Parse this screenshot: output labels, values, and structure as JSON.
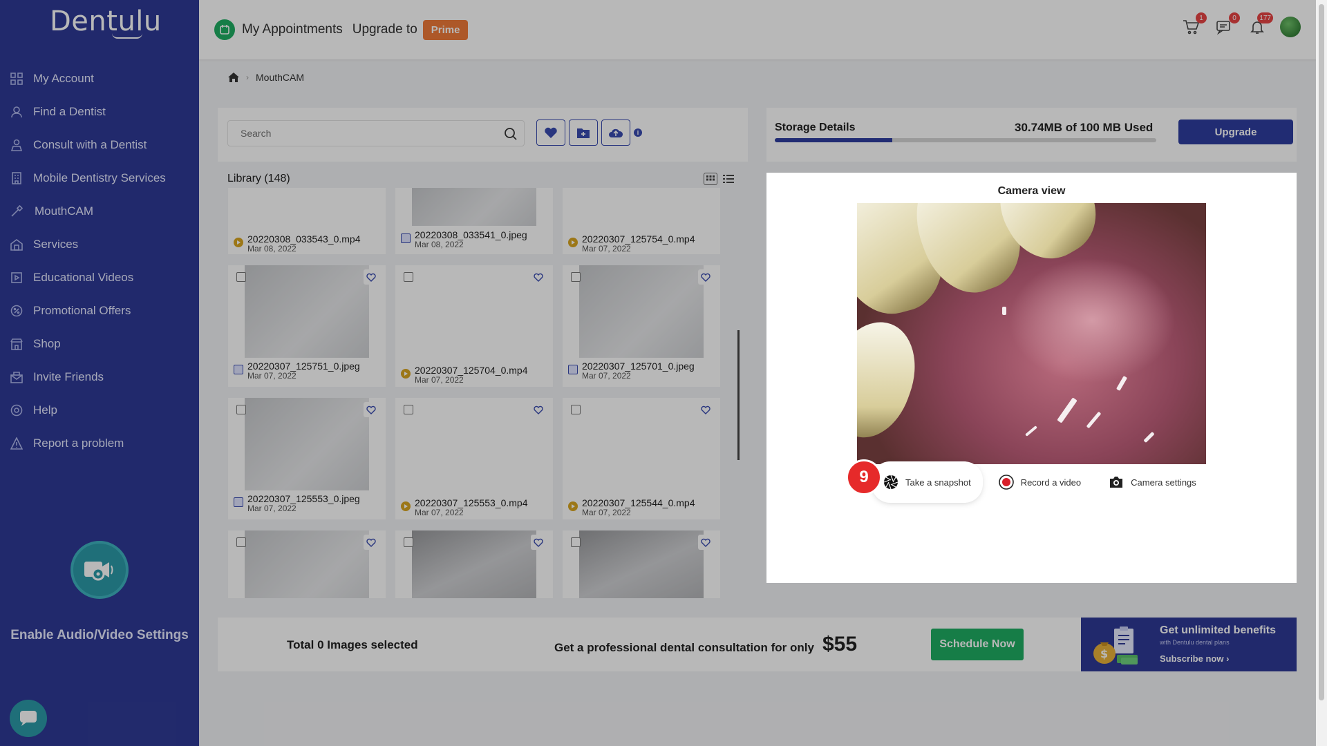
{
  "brand": {
    "logo_text": "Dentulu"
  },
  "sidebar": {
    "items": [
      {
        "label": "My Account",
        "icon": "grid-icon"
      },
      {
        "label": "Find a Dentist",
        "icon": "person-icon"
      },
      {
        "label": "Consult with a Dentist",
        "icon": "consult-icon"
      },
      {
        "label": "Mobile Dentistry Services",
        "icon": "building-icon"
      },
      {
        "label": "MouthCAM",
        "icon": "camera-wand-icon"
      },
      {
        "label": "Services",
        "icon": "services-icon"
      },
      {
        "label": "Educational Videos",
        "icon": "video-icon"
      },
      {
        "label": "Promotional Offers",
        "icon": "tag-icon"
      },
      {
        "label": "Shop",
        "icon": "shop-icon"
      },
      {
        "label": "Invite Friends",
        "icon": "invite-icon"
      },
      {
        "label": "Help",
        "icon": "help-icon"
      },
      {
        "label": "Report a problem",
        "icon": "warning-icon"
      }
    ],
    "av_settings_label": "Enable Audio/Video Settings"
  },
  "header": {
    "title": "My Appointments",
    "upgrade_text": "Upgrade to",
    "prime_label": "Prime",
    "cart_count": "1",
    "messages_count": "0",
    "notifications_count": "177"
  },
  "breadcrumb": {
    "current": "MouthCAM"
  },
  "toolbar": {
    "search_placeholder": "Search"
  },
  "library": {
    "title": "Library (148)",
    "items": [
      {
        "name": "20220308_033543_0.mp4",
        "date": "Mar 08, 2022",
        "type": "video"
      },
      {
        "name": "20220308_033541_0.jpeg",
        "date": "Mar 08, 2022",
        "type": "image"
      },
      {
        "name": "20220307_125754_0.mp4",
        "date": "Mar 07, 2022",
        "type": "video"
      },
      {
        "name": "20220307_125751_0.jpeg",
        "date": "Mar 07, 2022",
        "type": "image"
      },
      {
        "name": "20220307_125704_0.mp4",
        "date": "Mar 07, 2022",
        "type": "video"
      },
      {
        "name": "20220307_125701_0.jpeg",
        "date": "Mar 07, 2022",
        "type": "image"
      },
      {
        "name": "20220307_125553_0.jpeg",
        "date": "Mar 07, 2022",
        "type": "image"
      },
      {
        "name": "20220307_125553_0.mp4",
        "date": "Mar 07, 2022",
        "type": "video"
      },
      {
        "name": "20220307_125544_0.mp4",
        "date": "Mar 07, 2022",
        "type": "video"
      }
    ]
  },
  "storage": {
    "label": "Storage Details",
    "used_text": "30.74MB of 100 MB Used",
    "used_fraction": 0.3074,
    "upgrade_label": "Upgrade"
  },
  "camera": {
    "title": "Camera view",
    "snapshot_label": "Take a snapshot",
    "record_label": "Record a video",
    "settings_label": "Camera settings",
    "step_number": "9"
  },
  "footer": {
    "selected_text": "Total 0 Images selected",
    "promo_text": "Get a professional dental consultation for only",
    "price": "$55",
    "schedule_label": "Schedule Now",
    "banner_title": "Get unlimited benefits",
    "banner_small": "with Dentulu dental plans",
    "banner_link": "Subscribe now"
  },
  "colors": {
    "sidebar": "#2f3a96",
    "accent": "#2f3ea0",
    "prime": "#f07a3a",
    "success": "#1fae63",
    "step_badge": "#e62a2a"
  }
}
